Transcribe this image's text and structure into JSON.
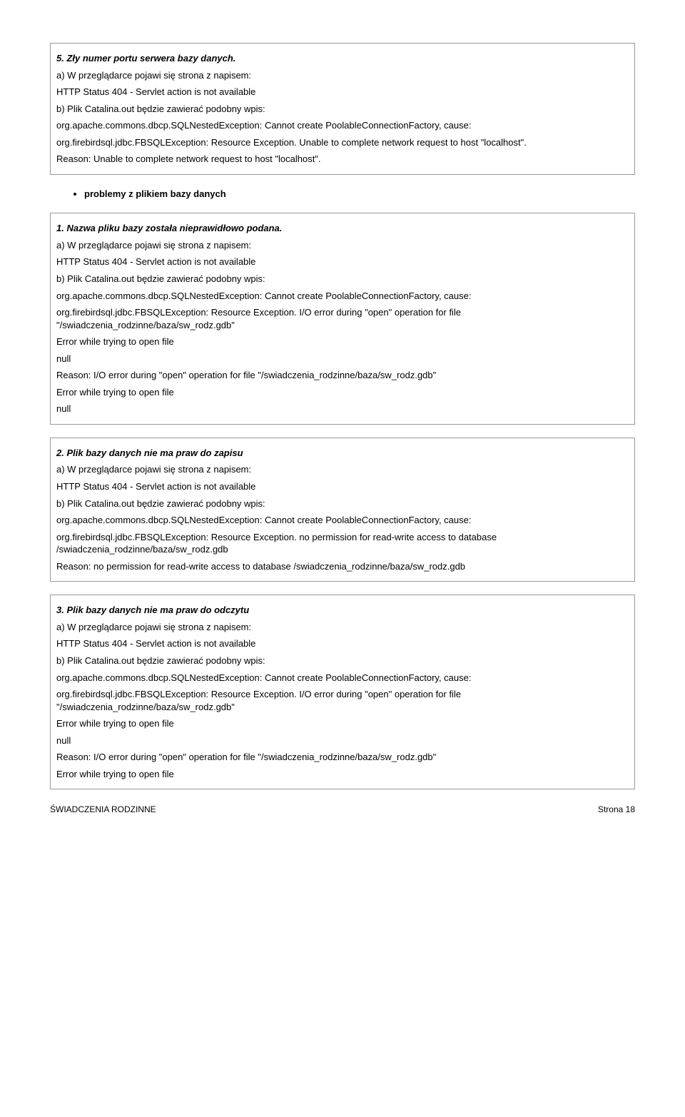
{
  "box5": {
    "title": "5. Zły numer portu serwera bazy danych.",
    "a": "a) W przeglądarce pojawi się strona z napisem:",
    "http": "HTTP Status 404 - Servlet action is not available",
    "b": "b) Plik Catalina.out będzie zawierać podobny wpis:",
    "ex1": "org.apache.commons.dbcp.SQLNestedException: Cannot create PoolableConnectionFactory, cause:",
    "ex2": "org.firebirdsql.jdbc.FBSQLException: Resource Exception. Unable to complete network request to host \"localhost\".",
    "reason": "Reason: Unable to complete network request to host \"localhost\"."
  },
  "bullet": "problemy z plikiem bazy danych",
  "box1": {
    "title": "1. Nazwa pliku bazy została nieprawidłowo podana.",
    "a": "a) W przeglądarce pojawi się strona z napisem:",
    "http": "HTTP Status 404 - Servlet action is not available",
    "b": "b) Plik Catalina.out będzie zawierać podobny wpis:",
    "ex1": "org.apache.commons.dbcp.SQLNestedException: Cannot create PoolableConnectionFactory, cause:",
    "ex2": "org.firebirdsql.jdbc.FBSQLException: Resource Exception. I/O error during \"open\" operation for file \"/swiadczenia_rodzinne/baza/sw_rodz.gdb\"",
    "err1": "Error while trying to open file",
    "null1": "null",
    "reason": "Reason: I/O error during \"open\" operation for file \"/swiadczenia_rodzinne/baza/sw_rodz.gdb\"",
    "err2": "Error while trying to open file",
    "null2": "null"
  },
  "box2": {
    "title": "2. Plik bazy danych nie ma praw do zapisu",
    "a": "a) W przeglądarce pojawi się strona z napisem:",
    "http": "HTTP Status 404 - Servlet action is not available",
    "b": "b) Plik Catalina.out będzie zawierać podobny wpis:",
    "ex1": "org.apache.commons.dbcp.SQLNestedException: Cannot create PoolableConnectionFactory, cause:",
    "ex2": "org.firebirdsql.jdbc.FBSQLException: Resource Exception. no permission for read-write access to database /swiadczenia_rodzinne/baza/sw_rodz.gdb",
    "reason": "Reason: no permission for read-write access to database /swiadczenia_rodzinne/baza/sw_rodz.gdb"
  },
  "box3": {
    "title": "3. Plik bazy danych nie ma praw do odczytu",
    "a": "a) W przeglądarce pojawi się strona z napisem:",
    "http": "HTTP Status 404 - Servlet action is not available",
    "b": "b) Plik Catalina.out będzie zawierać podobny wpis:",
    "ex1": "org.apache.commons.dbcp.SQLNestedException: Cannot create PoolableConnectionFactory, cause:",
    "ex2": "org.firebirdsql.jdbc.FBSQLException: Resource Exception. I/O error during \"open\" operation for file \"/swiadczenia_rodzinne/baza/sw_rodz.gdb\"",
    "err1": "Error while trying to open file",
    "null1": "null",
    "reason": "Reason: I/O error during \"open\" operation for file \"/swiadczenia_rodzinne/baza/sw_rodz.gdb\"",
    "err2": "Error while trying to open file"
  },
  "footer": {
    "left": "ŚWIADCZENIA RODZINNE",
    "right": "Strona 18"
  }
}
